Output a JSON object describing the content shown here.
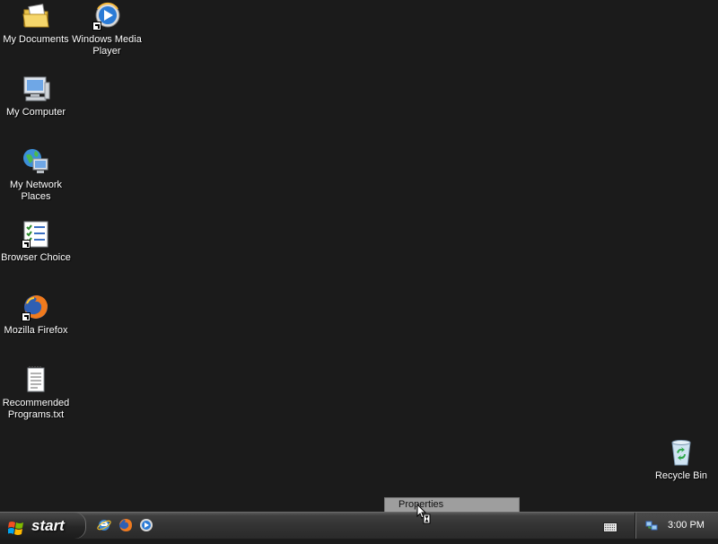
{
  "desktop": {
    "icons": [
      {
        "label": "My Documents",
        "icon": "my-documents-icon",
        "shortcut": false
      },
      {
        "label": "Windows Media Player",
        "icon": "windows-media-player-icon",
        "shortcut": true
      },
      {
        "label": "My Computer",
        "icon": "my-computer-icon",
        "shortcut": false
      },
      {
        "label": "My Network Places",
        "icon": "network-places-icon",
        "shortcut": false
      },
      {
        "label": "Browser Choice",
        "icon": "checklist-icon",
        "shortcut": true
      },
      {
        "label": "Mozilla Firefox",
        "icon": "firefox-icon",
        "shortcut": true
      },
      {
        "label": "Recommended Programs.txt",
        "icon": "text-file-icon",
        "shortcut": false
      },
      {
        "label": "Recycle Bin",
        "icon": "recycle-bin-icon",
        "shortcut": false
      }
    ]
  },
  "context_menu": {
    "item": "Properties"
  },
  "taskbar": {
    "start_label": "start",
    "quick_launch": [
      "internet-explorer-icon",
      "firefox-icon",
      "windows-media-player-icon"
    ],
    "clock": "3:00 PM"
  },
  "colors": {
    "desktop_bg": "#1b1b1b",
    "taskbar": "#333333",
    "text": "#ffffff"
  }
}
